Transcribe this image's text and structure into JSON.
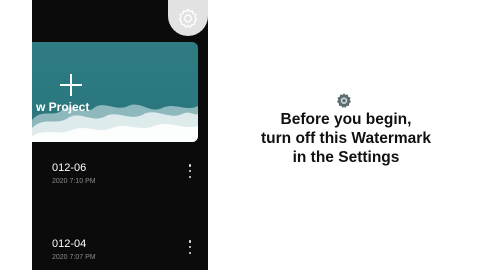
{
  "card": {
    "new_project_label": "w Project"
  },
  "projects": [
    {
      "title": "012-06",
      "date": "2020 7:10 PM"
    },
    {
      "title": "012-04",
      "date": "2020 7:07 PM"
    }
  ],
  "notice": {
    "line1": "Before you begin,",
    "line2": "turn off this Watermark",
    "line3": "in the Settings"
  },
  "icons": {
    "settings": "gear-icon",
    "hint": "gear-icon",
    "add": "plus-icon",
    "more": "more-vertical-icon"
  },
  "colors": {
    "phone_background": "#0b0b0b",
    "card_teal": "#2b7980",
    "settings_button": "#e2e2e2",
    "notice_text": "#111111"
  }
}
